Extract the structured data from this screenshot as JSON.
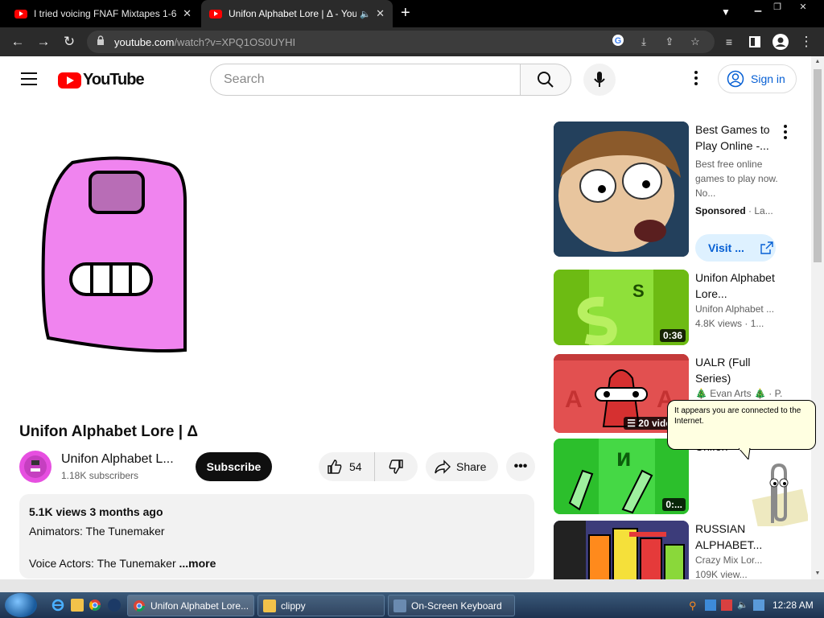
{
  "browser": {
    "tabs": [
      {
        "title": "I tried voicing FNAF Mixtapes 1-6",
        "active": false
      },
      {
        "title": "Unifon Alphabet Lore | Δ - YouTube",
        "active": true
      }
    ],
    "new_tab": "+",
    "url_host": "youtube.com",
    "url_path": "/watch?v=XPQ1OS0UYHI"
  },
  "youtube": {
    "logo_text": "YouTube",
    "search_placeholder": "Search",
    "sign_in": "Sign in"
  },
  "video": {
    "title": "Unifon Alphabet Lore | Δ",
    "channel_name": "Unifon Alphabet L...",
    "subscribers": "1.18K subscribers",
    "subscribe_label": "Subscribe",
    "likes": "54",
    "share_label": "Share",
    "description": {
      "meta": "5.1K views  3 months ago",
      "line1": "Animators: The Tunemaker",
      "line2": "Voice Actors: The Tunemaker",
      "more": "...more"
    }
  },
  "sidebar": {
    "ad": {
      "title": "Best Games to Play Online -...",
      "desc": "Best free online games to play now. No...",
      "sponsored": "Sponsored",
      "advertiser": "· La...",
      "visit": "Visit ..."
    },
    "items": [
      {
        "title": "Unifon Alphabet Lore...",
        "channel": "Unifon Alphabet ...",
        "meta": "4.8K views · 1...",
        "badge": "0:36"
      },
      {
        "title": "UALR (Full Series)",
        "channel": "🎄 Evan Arts 🎄 · P...",
        "meta": "",
        "badge": "20 videos"
      },
      {
        "title": "Unifon",
        "channel": "",
        "meta": "",
        "badge": "0:..."
      },
      {
        "title": "RUSSIAN ALPHABET...",
        "channel": "Crazy Mix Lor...",
        "meta": "109K view...",
        "badge": ""
      }
    ]
  },
  "clippy": {
    "message": "It appears you are connected to the Internet."
  },
  "taskbar": {
    "tasks": [
      {
        "label": "Unifon Alphabet Lore..."
      },
      {
        "label": "clippy"
      },
      {
        "label": "On-Screen Keyboard"
      }
    ],
    "clock": "12:28 AM"
  },
  "colors": {
    "brand_red": "#ff0000",
    "link_blue": "#065fd4",
    "character_pink": "#f084ef"
  }
}
